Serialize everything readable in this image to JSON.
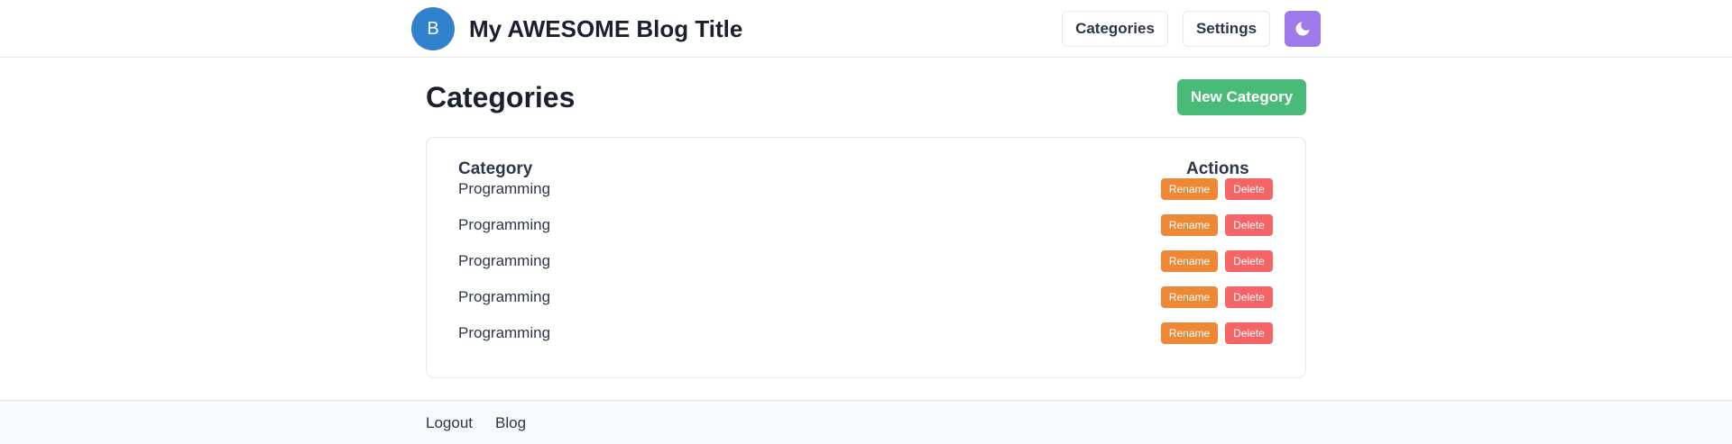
{
  "header": {
    "avatar_letter": "B",
    "site_title": "My AWESOME Blog Title",
    "nav": [
      "Categories",
      "Settings"
    ],
    "theme_icon": "moon-icon"
  },
  "main": {
    "title": "Categories",
    "new_button": "New Category",
    "table": {
      "columns": [
        "Category",
        "Actions"
      ],
      "rows": [
        {
          "name": "Programming",
          "rename": "Rename",
          "delete": "Delete"
        },
        {
          "name": "Programming",
          "rename": "Rename",
          "delete": "Delete"
        },
        {
          "name": "Programming",
          "rename": "Rename",
          "delete": "Delete"
        },
        {
          "name": "Programming",
          "rename": "Rename",
          "delete": "Delete"
        },
        {
          "name": "Programming",
          "rename": "Rename",
          "delete": "Delete"
        }
      ]
    }
  },
  "footer": {
    "links": [
      "Logout",
      "Blog"
    ]
  },
  "colors": {
    "avatar": "#3182ce",
    "theme_button": "#9f7aea",
    "new_button": "#48bb78",
    "rename": "#ed8936",
    "delete": "#f56565"
  }
}
